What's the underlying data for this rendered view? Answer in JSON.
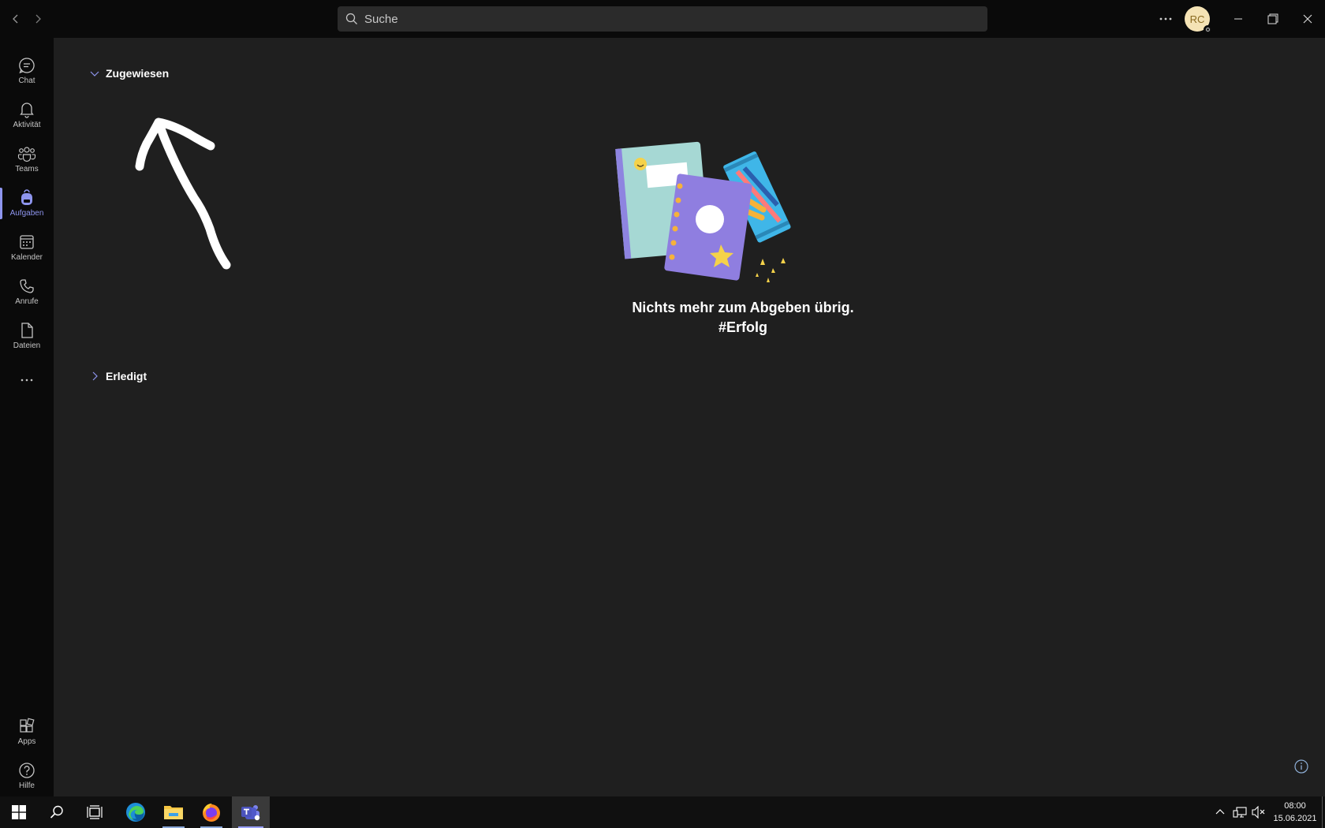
{
  "search": {
    "placeholder": "Suche"
  },
  "avatar": {
    "initials": "RC"
  },
  "rail": {
    "items": [
      {
        "label": "Chat"
      },
      {
        "label": "Aktivität"
      },
      {
        "label": "Teams"
      },
      {
        "label": "Aufgaben"
      },
      {
        "label": "Kalender"
      },
      {
        "label": "Anrufe"
      },
      {
        "label": "Dateien"
      }
    ],
    "bottom": [
      {
        "label": "Apps"
      },
      {
        "label": "Hilfe"
      }
    ]
  },
  "main": {
    "sections": [
      {
        "label": "Zugewiesen",
        "expanded": true
      },
      {
        "label": "Erledigt",
        "expanded": false
      }
    ],
    "empty_line1": "Nichts mehr zum Abgeben übrig.",
    "empty_line2": "#Erfolg"
  },
  "colors": {
    "accent": "#8e95ee",
    "background": "#1f1f1f",
    "rail": "#0a0a0a"
  },
  "taskbar": {
    "time": "08:00",
    "date": "15.06.2021"
  }
}
